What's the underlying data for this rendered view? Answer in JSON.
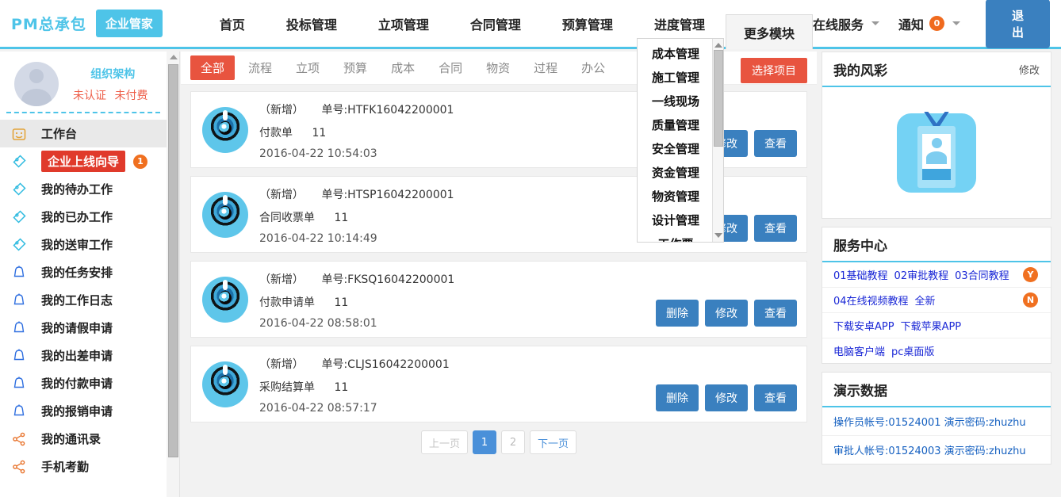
{
  "header": {
    "brand": "PM总承包",
    "brand_chip": "企业管家",
    "nav": [
      {
        "label": "首页",
        "name": "nav-home"
      },
      {
        "label": "投标管理",
        "name": "nav-bidding"
      },
      {
        "label": "立项管理",
        "name": "nav-project-setup"
      },
      {
        "label": "合同管理",
        "name": "nav-contract"
      },
      {
        "label": "预算管理",
        "name": "nav-budget"
      },
      {
        "label": "进度管理",
        "name": "nav-schedule"
      }
    ],
    "more_label": "更多模块",
    "online_service": "在线服务",
    "notify": "通知",
    "notify_count": "0",
    "logout": "退出"
  },
  "dropdown": {
    "items": [
      "成本管理",
      "施工管理",
      "一线现场",
      "质量管理",
      "安全管理",
      "资金管理",
      "物资管理",
      "设计管理",
      "工作票"
    ]
  },
  "sidebar": {
    "org_link": "组织架构",
    "status": [
      "未认证",
      "未付费"
    ],
    "items": [
      {
        "label": "工作台",
        "icon": "workbench-icon",
        "active": true,
        "highlight": false,
        "badge": ""
      },
      {
        "label": "企业上线向导",
        "icon": "tag-icon",
        "active": false,
        "highlight": true,
        "badge": "1"
      },
      {
        "label": "我的待办工作",
        "icon": "tag-icon",
        "active": false,
        "highlight": false,
        "badge": ""
      },
      {
        "label": "我的已办工作",
        "icon": "tag-icon",
        "active": false,
        "highlight": false,
        "badge": ""
      },
      {
        "label": "我的送审工作",
        "icon": "tag-icon",
        "active": false,
        "highlight": false,
        "badge": ""
      },
      {
        "label": "我的任务安排",
        "icon": "bell-icon",
        "active": false,
        "highlight": false,
        "badge": ""
      },
      {
        "label": "我的工作日志",
        "icon": "bell-icon",
        "active": false,
        "highlight": false,
        "badge": ""
      },
      {
        "label": "我的请假申请",
        "icon": "bell-icon",
        "active": false,
        "highlight": false,
        "badge": ""
      },
      {
        "label": "我的出差申请",
        "icon": "bell-icon",
        "active": false,
        "highlight": false,
        "badge": ""
      },
      {
        "label": "我的付款申请",
        "icon": "bell-icon",
        "active": false,
        "highlight": false,
        "badge": ""
      },
      {
        "label": "我的报销申请",
        "icon": "bell-icon",
        "active": false,
        "highlight": false,
        "badge": ""
      },
      {
        "label": "我的通讯录",
        "icon": "share-icon",
        "active": false,
        "highlight": false,
        "badge": ""
      },
      {
        "label": "手机考勤",
        "icon": "share-icon",
        "active": false,
        "highlight": false,
        "badge": ""
      }
    ]
  },
  "main": {
    "tabs": [
      {
        "label": "全部",
        "active": true
      },
      {
        "label": "流程",
        "active": false
      },
      {
        "label": "立项",
        "active": false
      },
      {
        "label": "预算",
        "active": false
      },
      {
        "label": "成本",
        "active": false
      },
      {
        "label": "合同",
        "active": false
      },
      {
        "label": "物资",
        "active": false
      },
      {
        "label": "过程",
        "active": false
      },
      {
        "label": "办公",
        "active": false
      }
    ],
    "select_project": "选择项目",
    "actions": {
      "delete": "删除",
      "edit": "修改",
      "view": "查看"
    },
    "cards": [
      {
        "state": "（新增）",
        "no_label": "单号:HTFK16042200001",
        "type": "付款单",
        "count": "11",
        "time": "2016-04-22 10:54:03"
      },
      {
        "state": "（新增）",
        "no_label": "单号:HTSP16042200001",
        "type": "合同收票单",
        "count": "11",
        "time": "2016-04-22 10:14:49"
      },
      {
        "state": "（新增）",
        "no_label": "单号:FKSQ16042200001",
        "type": "付款申请单",
        "count": "11",
        "time": "2016-04-22 08:58:01"
      },
      {
        "state": "（新增）",
        "no_label": "单号:CLJS16042200001",
        "type": "采购结算单",
        "count": "11",
        "time": "2016-04-22 08:57:17"
      }
    ],
    "pager": {
      "prev": "上一页",
      "pages": [
        "1",
        "2"
      ],
      "current": "1",
      "next": "下一页"
    }
  },
  "right": {
    "profile_panel": {
      "title": "我的风彩",
      "action": "修改"
    },
    "service_panel": {
      "title": "服务中心",
      "rows": [
        {
          "links": [
            "01基础教程",
            "02审批教程",
            "03合同教程"
          ],
          "badge": "Y"
        },
        {
          "links": [
            "04在线视频教程",
            "全新"
          ],
          "badge": "N"
        },
        {
          "links": [
            "下载安卓APP",
            "下载苹果APP"
          ],
          "badge": ""
        },
        {
          "links": [
            "电脑客户端",
            "pc桌面版"
          ],
          "badge": ""
        }
      ]
    },
    "demo_panel": {
      "title": "演示数据",
      "rows": [
        "操作员帐号:01524001  演示密码:zhuzhu",
        "审批人帐号:01524003  演示密码:zhuzhu"
      ]
    }
  },
  "colors": {
    "accent_blue": "#4ec4e8",
    "accent_red": "#e8543f",
    "button_blue": "#3a80bf",
    "badge_orange": "#f07020",
    "link_blue": "#1a27d6"
  }
}
